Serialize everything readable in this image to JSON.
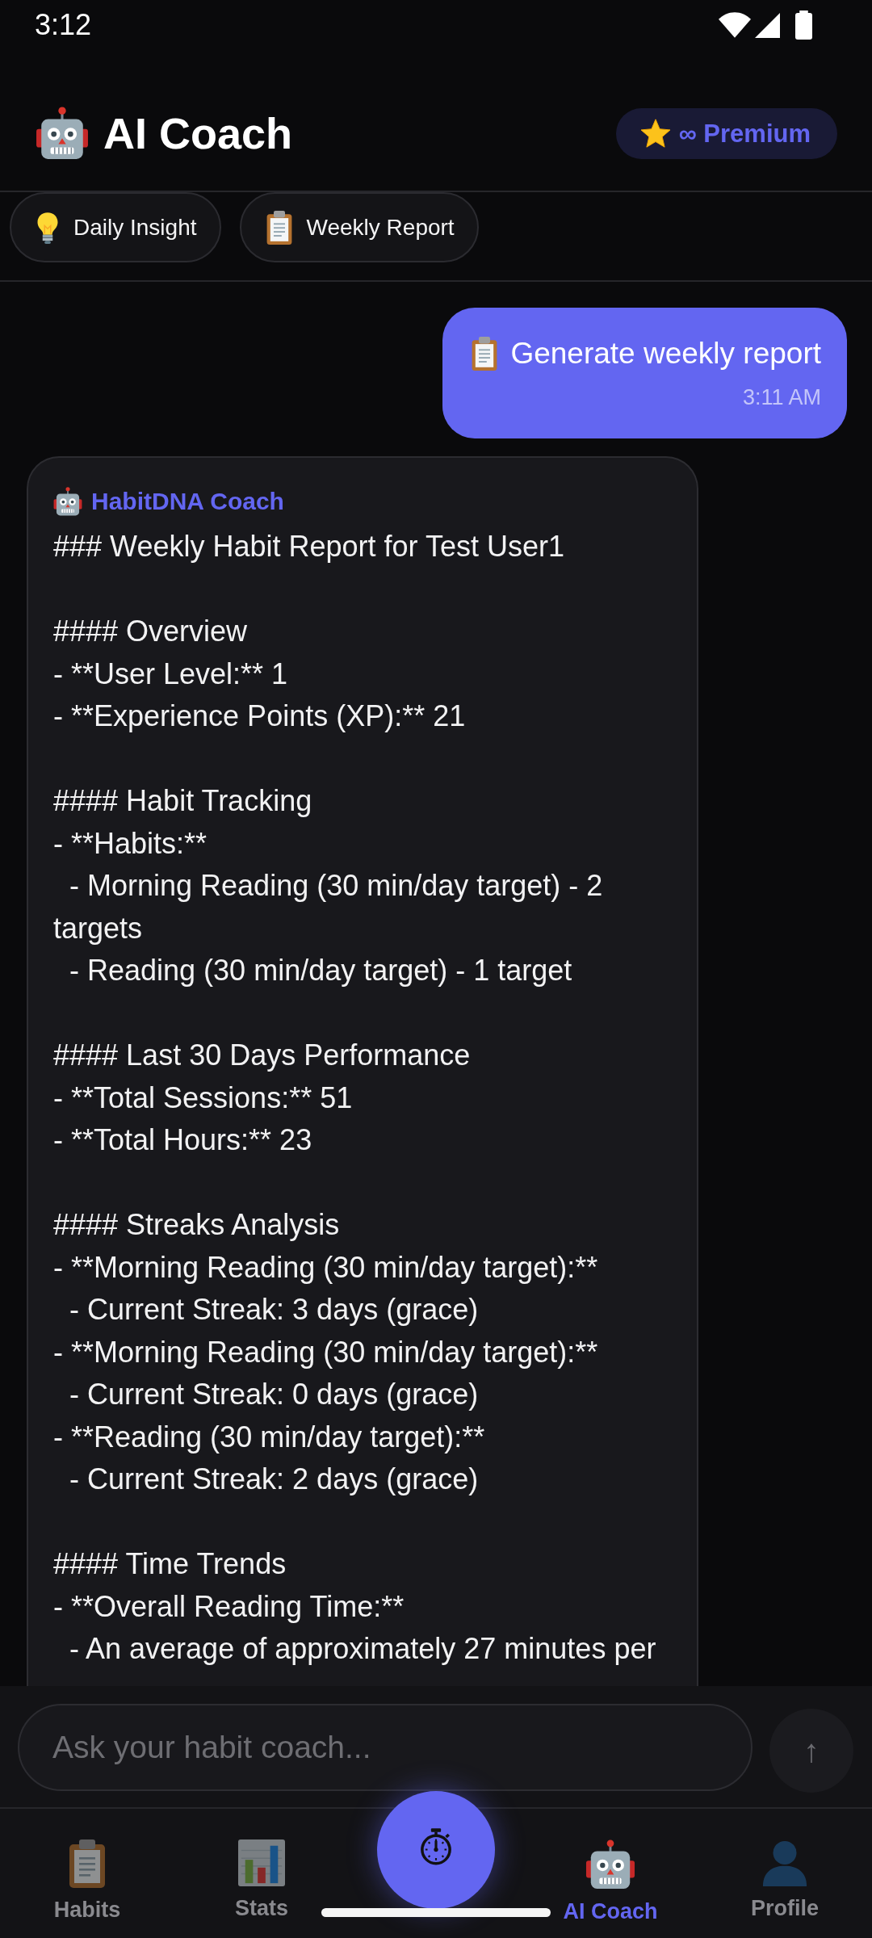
{
  "status_bar": {
    "time": "3:12"
  },
  "header": {
    "title": "AI Coach",
    "badge": "∞ Premium"
  },
  "quick_actions": [
    {
      "label": "Daily Insight"
    },
    {
      "label": "Weekly Report"
    }
  ],
  "messages": [
    {
      "kind": "user",
      "text": "Generate weekly report",
      "time": "3:11 AM"
    },
    {
      "kind": "coach",
      "sender": "HabitDNA Coach",
      "sections": [
        {
          "lines": [
            "### Weekly Habit Report for Test User1"
          ]
        },
        {
          "lines": [
            "#### Overview",
            "- **User Level:** 1",
            "- **Experience Points (XP):** 21"
          ]
        },
        {
          "lines": [
            "#### Habit Tracking",
            "- **Habits:**",
            "  - Morning Reading (30 min/day target) - 2 targets",
            "  - Reading (30 min/day target) - 1 target"
          ]
        },
        {
          "lines": [
            "#### Last 30 Days Performance",
            "- **Total Sessions:** 51",
            "- **Total Hours:** 23"
          ]
        },
        {
          "lines": [
            "#### Streaks Analysis",
            "- **Morning Reading (30 min/day target):**",
            "  - Current Streak: 3 days (grace)",
            "- **Morning Reading (30 min/day target):**",
            "  - Current Streak: 0 days (grace)",
            "- **Reading (30 min/day target):**",
            "  - Current Streak: 2 days (grace)"
          ]
        },
        {
          "lines": [
            "#### Time Trends",
            "- **Overall Reading Time:**",
            "  - An average of approximately 27 minutes per"
          ]
        }
      ]
    }
  ],
  "composer": {
    "placeholder": "Ask your habit coach...",
    "send_button": {
      "label": "↑",
      "disabled": true
    }
  },
  "bottom_nav": [
    {
      "label": "Habits",
      "selected": false
    },
    {
      "label": "Stats",
      "selected": false
    },
    {
      "label": "AI Coach",
      "selected": true
    },
    {
      "label": "Profile",
      "selected": false
    }
  ]
}
